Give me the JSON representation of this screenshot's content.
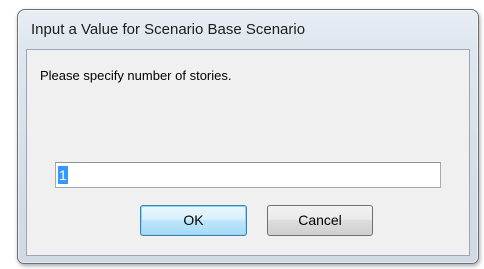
{
  "window": {
    "title": "Input a Value for Scenario Base Scenario"
  },
  "dialog": {
    "prompt": "Please specify number of stories.",
    "input_value": "1",
    "ok_label": "OK",
    "cancel_label": "Cancel"
  },
  "colors": {
    "selection": "#3399ff",
    "default_button_border": "#3c7fb1"
  }
}
